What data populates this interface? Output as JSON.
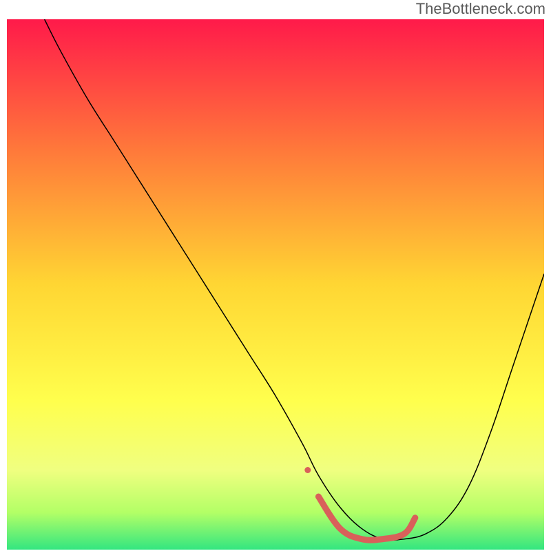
{
  "watermark": "TheBottleneck.com",
  "chart_data": {
    "type": "line",
    "title": "",
    "xlabel": "",
    "ylabel": "",
    "xlim": [
      0,
      100
    ],
    "ylim": [
      0,
      100
    ],
    "gradient_stops": [
      {
        "offset": 0,
        "color": "#ff1a4a"
      },
      {
        "offset": 25,
        "color": "#ff7a3a"
      },
      {
        "offset": 50,
        "color": "#ffd633"
      },
      {
        "offset": 72,
        "color": "#ffff4d"
      },
      {
        "offset": 85,
        "color": "#f0ff80"
      },
      {
        "offset": 93,
        "color": "#b3ff66"
      },
      {
        "offset": 100,
        "color": "#33e680"
      }
    ],
    "series": [
      {
        "name": "curve",
        "color": "#000000",
        "width": 1.5,
        "x": [
          7,
          10,
          15,
          20,
          25,
          30,
          35,
          40,
          45,
          50,
          55,
          58,
          62,
          66,
          70,
          74,
          78,
          82,
          86,
          90,
          94,
          98,
          100
        ],
        "y": [
          100,
          94,
          85,
          77,
          69,
          61,
          53,
          45,
          37,
          29,
          20,
          14,
          8,
          4,
          2,
          2,
          3,
          6,
          12,
          22,
          34,
          46,
          52
        ]
      },
      {
        "name": "highlight",
        "color": "#d9605a",
        "width": 9,
        "x": [
          58,
          62,
          66,
          70,
          74,
          76
        ],
        "y": [
          10,
          4,
          2,
          2,
          3,
          6
        ]
      }
    ],
    "highlight_dot": {
      "x": 56,
      "y": 15,
      "r": 4.5,
      "color": "#d9605a"
    }
  }
}
